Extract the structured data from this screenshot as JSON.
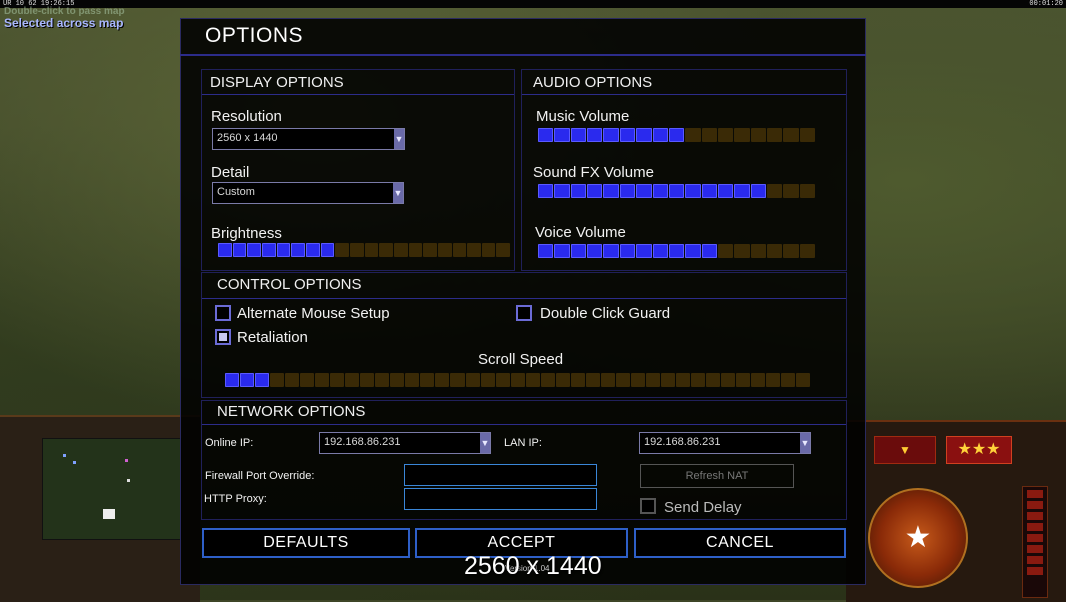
{
  "hud": {
    "top_left_clock": "UR 10 62 19:26:15",
    "top_right_clock": "00:01:20",
    "ticker": "Double-click to pass map",
    "status": "Selected across map",
    "rank_stars": "★★★",
    "arrow": "▼"
  },
  "options": {
    "title": "OPTIONS",
    "display": {
      "heading": "DISPLAY OPTIONS",
      "resolution_label": "Resolution",
      "resolution_value": "2560 x 1440",
      "detail_label": "Detail",
      "detail_value": "Custom",
      "brightness_label": "Brightness",
      "brightness_level": 0.42
    },
    "audio": {
      "heading": "AUDIO OPTIONS",
      "music_label": "Music Volume",
      "music_level": 0.53,
      "sfx_label": "Sound FX Volume",
      "sfx_level": 0.8,
      "voice_label": "Voice Volume",
      "voice_level": 0.67
    },
    "control": {
      "heading": "CONTROL OPTIONS",
      "alt_mouse_label": "Alternate Mouse Setup",
      "alt_mouse_checked": false,
      "double_click_label": "Double Click Guard",
      "double_click_checked": false,
      "retaliation_label": "Retaliation",
      "retaliation_checked": true,
      "scroll_label": "Scroll Speed",
      "scroll_level": 0.08
    },
    "network": {
      "heading": "NETWORK OPTIONS",
      "online_ip_label": "Online IP:",
      "online_ip_value": "192.168.86.231",
      "lan_ip_label": "LAN IP:",
      "lan_ip_value": "192.168.86.231",
      "firewall_label": "Firewall Port Override:",
      "firewall_value": "",
      "http_proxy_label": "HTTP Proxy:",
      "http_proxy_value": "",
      "refresh_nat_label": "Refresh NAT",
      "send_delay_label": "Send Delay",
      "send_delay_checked": false
    },
    "buttons": {
      "defaults": "DEFAULTS",
      "accept": "ACCEPT",
      "cancel": "CANCEL"
    },
    "resolution_overlay": "2560 x 1440",
    "version": "Version 1.04"
  },
  "colors": {
    "slider_on": "#2a2aee",
    "slider_off": "#3a2a06",
    "panel_border": "#2c2c8a",
    "button_border": "#2e5fc8"
  }
}
